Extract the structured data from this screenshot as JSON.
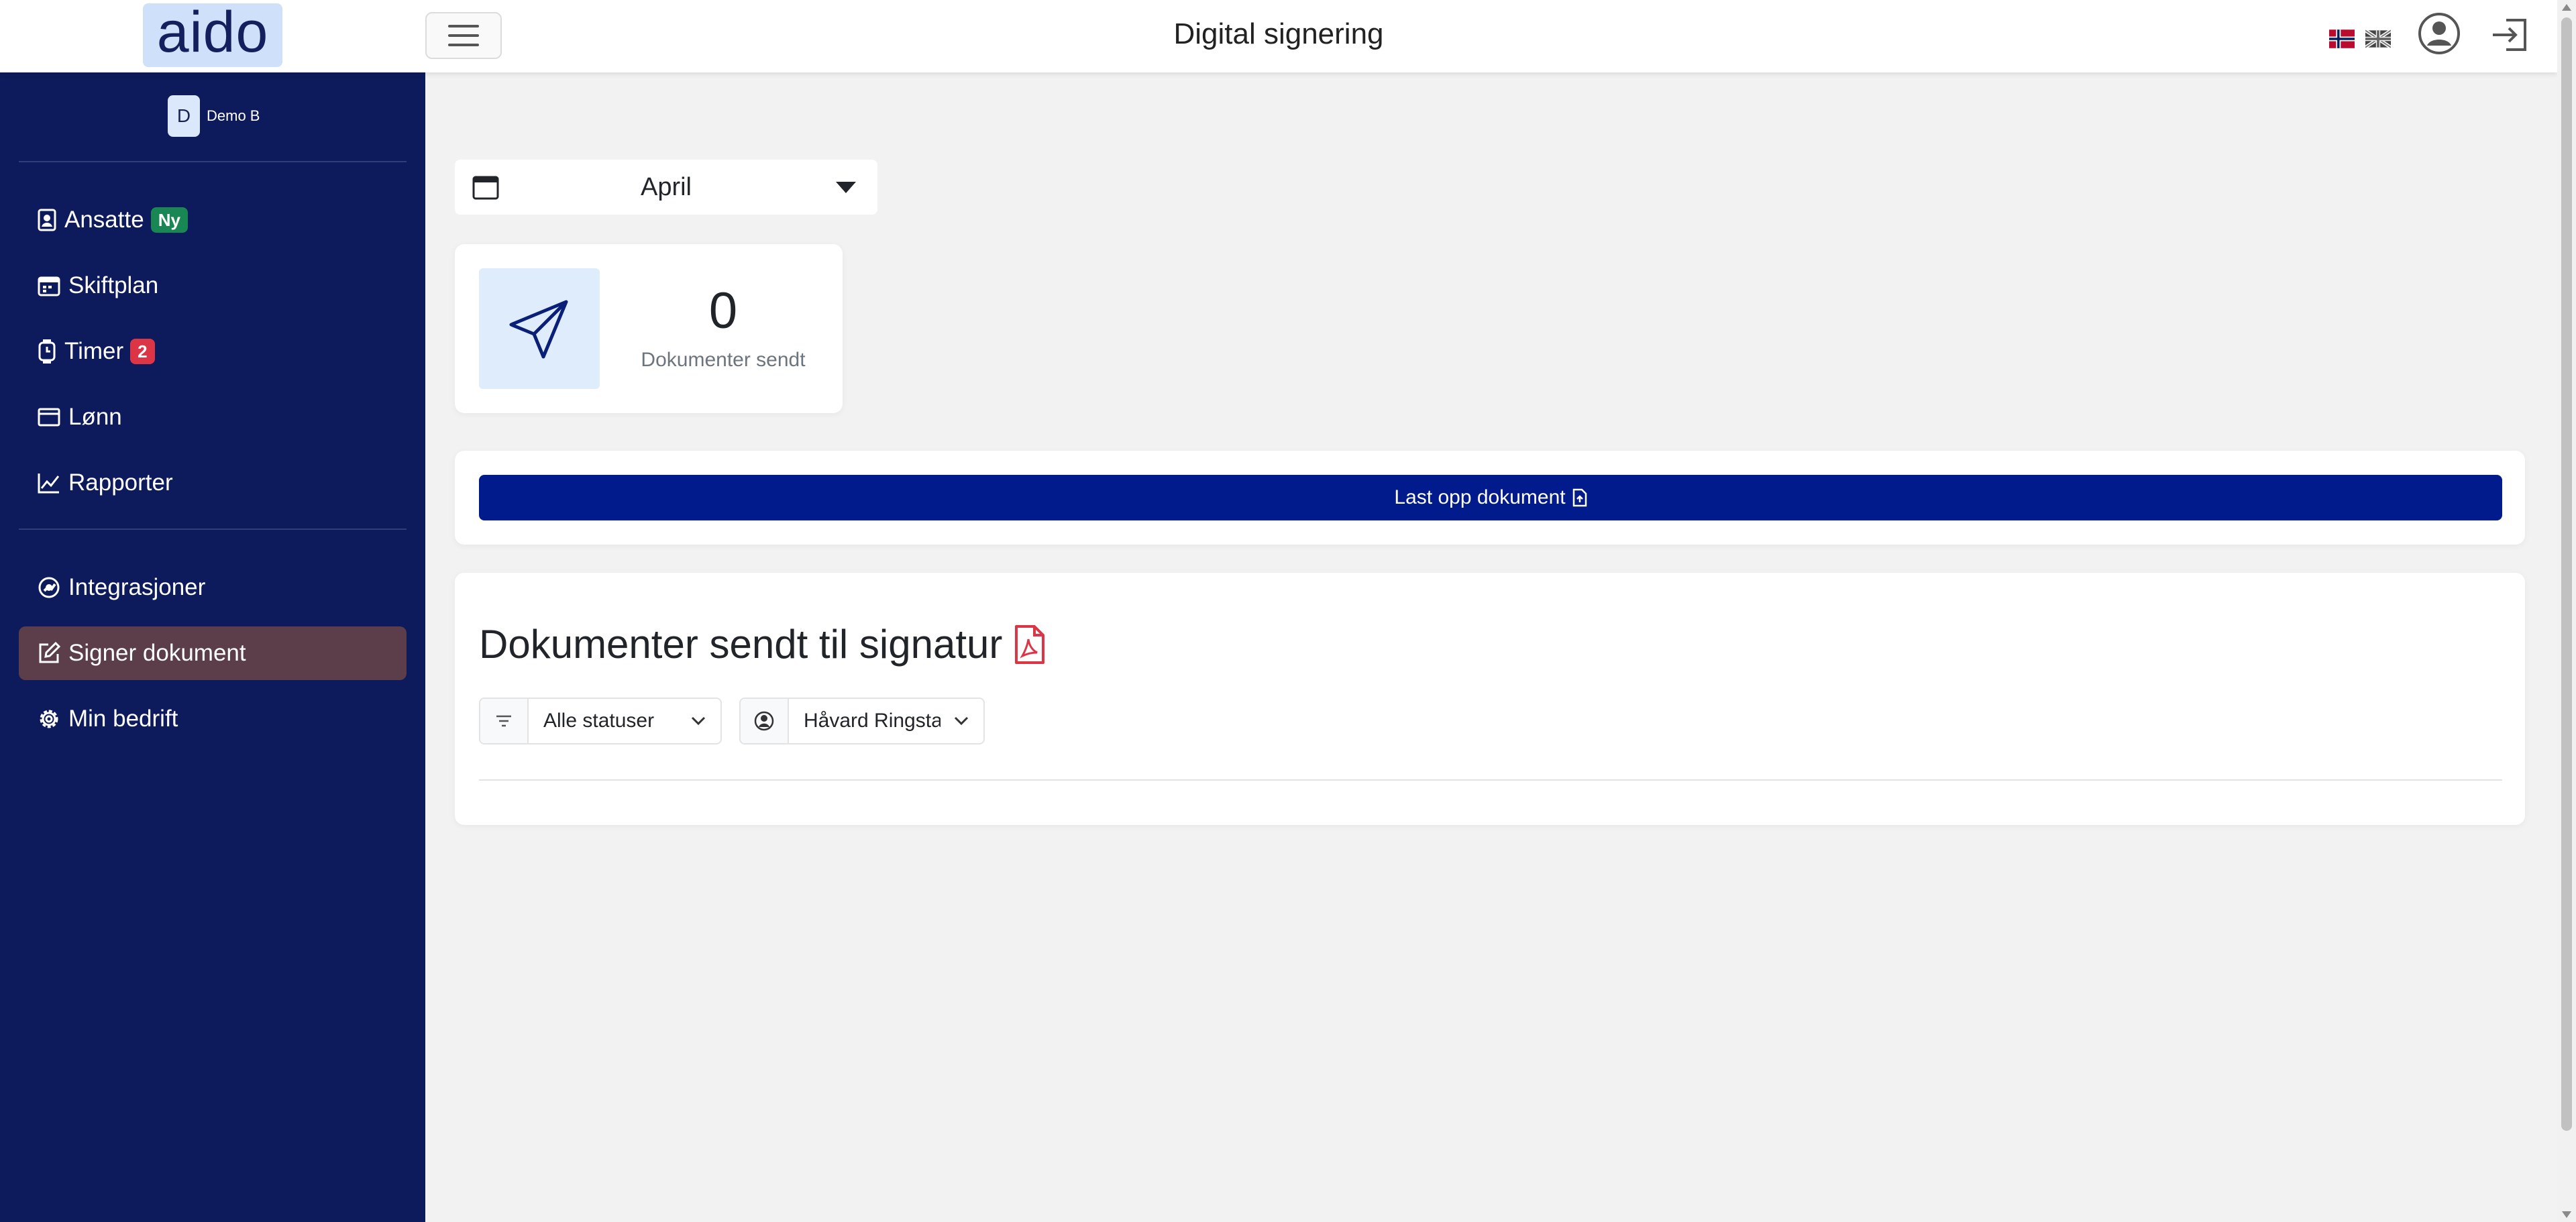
{
  "header": {
    "logo_text": "aido",
    "title": "Digital signering",
    "flags": [
      "norway-flag",
      "uk-flag"
    ],
    "icons": [
      "menu-icon",
      "user-circle-icon",
      "logout-icon"
    ]
  },
  "sidebar": {
    "user": {
      "initial": "D",
      "name": "Demo B"
    },
    "items": [
      {
        "label": "Ansatte",
        "icon": "person-badge-icon",
        "badge": "Ny",
        "badge_color": "#198754"
      },
      {
        "label": "Skiftplan",
        "icon": "calendar-week-icon"
      },
      {
        "label": "Timer",
        "icon": "smartwatch-icon",
        "badge": "2",
        "badge_color": "#dc3545"
      },
      {
        "label": "Lønn",
        "icon": "wallet-icon"
      },
      {
        "label": "Rapporter",
        "icon": "chart-line-icon"
      },
      {
        "label": "Integrasjoner",
        "icon": "integration-icon"
      },
      {
        "label": "Signer dokument",
        "icon": "pencil-square-icon",
        "active": true
      },
      {
        "label": "Min bedrift",
        "icon": "gear-icon"
      }
    ]
  },
  "main": {
    "month_select": {
      "value": "April"
    },
    "stat": {
      "value": "0",
      "label": "Dokumenter sendt",
      "icon": "send-icon"
    },
    "upload_button": {
      "label": "Last opp dokument",
      "icon": "file-upload-icon"
    },
    "documents": {
      "title": "Dokumenter sendt til signatur",
      "title_icon": "pdf-file-icon",
      "status_filter": {
        "value": "Alle statuser",
        "icon": "filter-icon"
      },
      "person_filter": {
        "value": "Håvard Ringstad",
        "icon": "person-circle-icon"
      }
    }
  },
  "colors": {
    "sidebar_bg": "#0d1b5c",
    "active_item_bg": "#5b3e49",
    "primary_button": "#011a8c",
    "stat_icon_bg": "#deecfb",
    "pdf_red": "#dc3545"
  }
}
